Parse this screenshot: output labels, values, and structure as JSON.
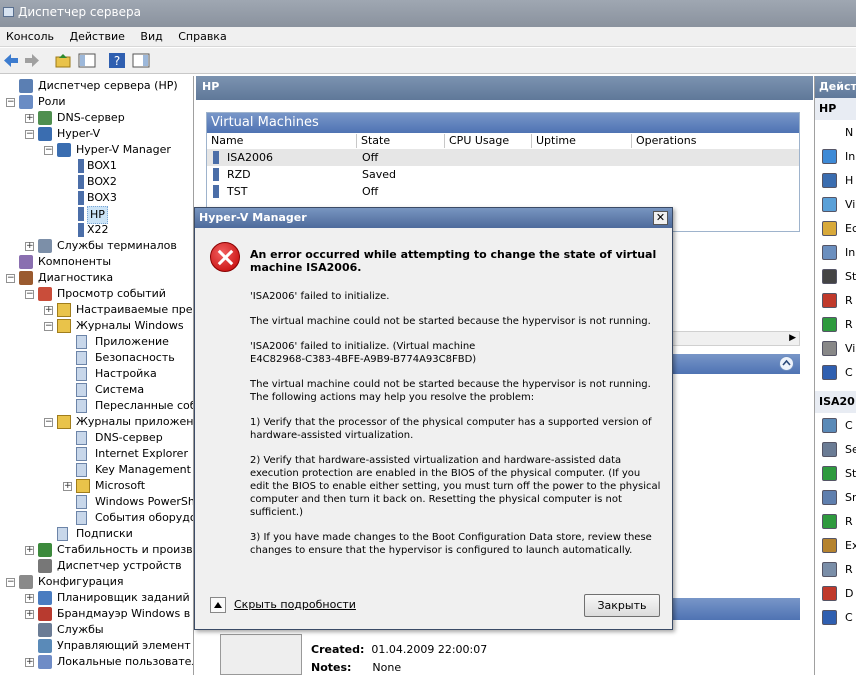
{
  "window": {
    "title": "Диспетчер сервера"
  },
  "menu": [
    "Консоль",
    "Действие",
    "Вид",
    "Справка"
  ],
  "tree": [
    {
      "label": "Диспетчер сервера (HP)",
      "depth": 0,
      "exp": "",
      "icon": "server"
    },
    {
      "label": "Роли",
      "depth": 0,
      "exp": "-",
      "icon": "roles"
    },
    {
      "label": "DNS-сервер",
      "depth": 1,
      "exp": "+",
      "icon": "dns"
    },
    {
      "label": "Hyper-V",
      "depth": 1,
      "exp": "-",
      "icon": "hyperv"
    },
    {
      "label": "Hyper-V Manager",
      "depth": 2,
      "exp": "-",
      "icon": "hyperv"
    },
    {
      "label": "BOX1",
      "depth": 3,
      "exp": "",
      "icon": "vmserver"
    },
    {
      "label": "BOX2",
      "depth": 3,
      "exp": "",
      "icon": "vmserver"
    },
    {
      "label": "BOX3",
      "depth": 3,
      "exp": "",
      "icon": "vmserver"
    },
    {
      "label": "HP",
      "depth": 3,
      "exp": "",
      "icon": "vmserver",
      "selected": true
    },
    {
      "label": "X22",
      "depth": 3,
      "exp": "",
      "icon": "vmserver"
    },
    {
      "label": "Службы терминалов",
      "depth": 1,
      "exp": "+",
      "icon": "terminal"
    },
    {
      "label": "Компоненты",
      "depth": 0,
      "exp": "",
      "icon": "components"
    },
    {
      "label": "Диагностика",
      "depth": 0,
      "exp": "-",
      "icon": "diag"
    },
    {
      "label": "Просмотр событий",
      "depth": 1,
      "exp": "-",
      "icon": "events"
    },
    {
      "label": "Настраиваемые предс",
      "depth": 2,
      "exp": "+",
      "icon": "folder"
    },
    {
      "label": "Журналы Windows",
      "depth": 2,
      "exp": "-",
      "icon": "folder"
    },
    {
      "label": "Приложение",
      "depth": 3,
      "exp": "",
      "icon": "log"
    },
    {
      "label": "Безопасность",
      "depth": 3,
      "exp": "",
      "icon": "log"
    },
    {
      "label": "Настройка",
      "depth": 3,
      "exp": "",
      "icon": "log"
    },
    {
      "label": "Система",
      "depth": 3,
      "exp": "",
      "icon": "log"
    },
    {
      "label": "Пересланные собы",
      "depth": 3,
      "exp": "",
      "icon": "log"
    },
    {
      "label": "Журналы приложени",
      "depth": 2,
      "exp": "-",
      "icon": "folder"
    },
    {
      "label": "DNS-сервер",
      "depth": 3,
      "exp": "",
      "icon": "log"
    },
    {
      "label": "Internet Explorer",
      "depth": 3,
      "exp": "",
      "icon": "log"
    },
    {
      "label": "Key Management S",
      "depth": 3,
      "exp": "",
      "icon": "log"
    },
    {
      "label": "Microsoft",
      "depth": 3,
      "exp": "+",
      "icon": "folder"
    },
    {
      "label": "Windows PowerShe",
      "depth": 3,
      "exp": "",
      "icon": "log"
    },
    {
      "label": "События оборудо",
      "depth": 3,
      "exp": "",
      "icon": "log"
    },
    {
      "label": "Подписки",
      "depth": 2,
      "exp": "",
      "icon": "log"
    },
    {
      "label": "Стабильность и производ",
      "depth": 1,
      "exp": "+",
      "icon": "perf"
    },
    {
      "label": "Диспетчер устройств",
      "depth": 1,
      "exp": "",
      "icon": "devices"
    },
    {
      "label": "Конфигурация",
      "depth": 0,
      "exp": "-",
      "icon": "config"
    },
    {
      "label": "Планировщик заданий",
      "depth": 1,
      "exp": "+",
      "icon": "scheduler"
    },
    {
      "label": "Брандмауэр Windows в ре",
      "depth": 1,
      "exp": "+",
      "icon": "firewall"
    },
    {
      "label": "Службы",
      "depth": 1,
      "exp": "",
      "icon": "services"
    },
    {
      "label": "Управляющий элемент W",
      "depth": 1,
      "exp": "",
      "icon": "wmi"
    },
    {
      "label": "Локальные пользователи",
      "depth": 1,
      "exp": "+",
      "icon": "users"
    }
  ],
  "center": {
    "header": "HP",
    "vm_title": "Virtual Machines",
    "columns": [
      "Name",
      "State",
      "CPU Usage",
      "Uptime",
      "Operations"
    ],
    "rows": [
      {
        "name": "ISA2006",
        "state": "Off",
        "cpu": "",
        "uptime": "",
        "ops": ""
      },
      {
        "name": "RZD",
        "state": "Saved",
        "cpu": "",
        "uptime": "",
        "ops": ""
      },
      {
        "name": "TST",
        "state": "Off",
        "cpu": "",
        "uptime": "",
        "ops": ""
      }
    ],
    "created_label": "Created:",
    "created_value": "01.04.2009 22:00:07",
    "notes_label": "Notes:",
    "notes_value": "None"
  },
  "actions": {
    "header": "Дейст",
    "section1": "HP",
    "section2": "ISA20",
    "items1": [
      "N",
      "In",
      "H",
      "Vi",
      "Ec",
      "In",
      "St",
      "R",
      "R",
      "Vi",
      "C"
    ],
    "items2": [
      "C",
      "Se",
      "St",
      "Sr",
      "R",
      "Ex",
      "R",
      "D",
      "C"
    ],
    "icons1": [
      "none",
      "import",
      "hyperv",
      "virtual",
      "edit",
      "inspect",
      "stop",
      "remove",
      "refresh",
      "view",
      "help"
    ],
    "icons2": [
      "connect",
      "settings",
      "start",
      "snapshot",
      "revert",
      "export",
      "rename",
      "delete",
      "help"
    ]
  },
  "dialog": {
    "title": "Hyper-V Manager",
    "main": "An error occurred while attempting to change the state of virtual machine ISA2006.",
    "paragraphs": [
      "'ISA2006' failed to initialize.",
      "The virtual machine could not be started because the hypervisor is not running.",
      "'ISA2006' failed to initialize. (Virtual machine E4C82968-C383-4BFE-A9B9-B774A93C8FBD)",
      "The virtual machine could not be started because the hypervisor is not running.  The following actions may help you resolve the problem:",
      "1) Verify that the processor of the physical computer has a supported version of hardware-assisted virtualization.",
      "2) Verify that hardware-assisted virtualization and hardware-assisted data execution protection are enabled in the BIOS of the physical computer.  (If you edit the BIOS to enable either setting, you must turn off the power to the physical computer and then turn it back on.  Resetting the physical computer is not sufficient.)",
      "3) If you have made changes to the Boot Configuration Data store, review these changes to ensure that the hypervisor is configured to launch automatically."
    ],
    "less_details": "Скрыть подробности",
    "close_button": "Закрыть"
  }
}
